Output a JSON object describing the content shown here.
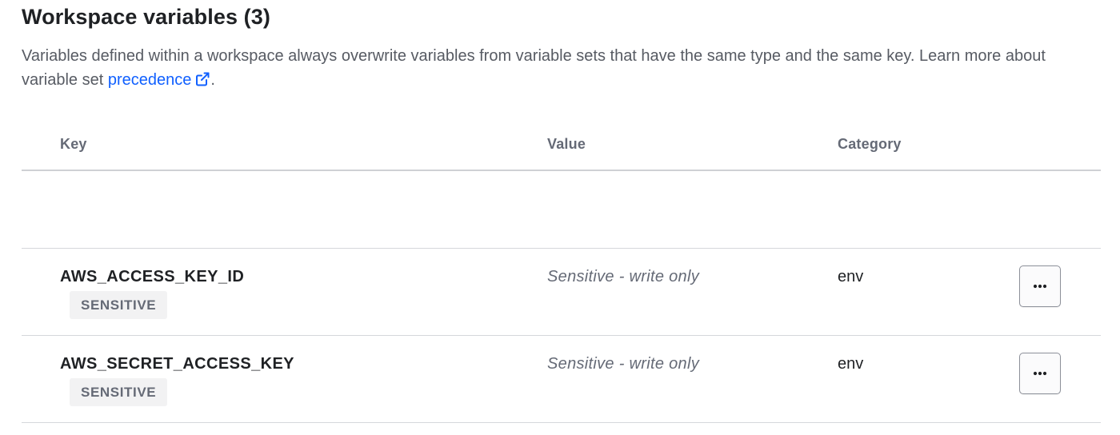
{
  "header": {
    "title": "Workspace variables (3)",
    "description_before": "Variables defined within a workspace always overwrite variables from variable sets that have the same type and the same key. Learn more about variable set ",
    "link_text": "precedence",
    "description_after": ".",
    "link_icon": "external-link-icon"
  },
  "table": {
    "columns": {
      "key": "Key",
      "value": "Value",
      "category": "Category"
    },
    "rows": [
      {
        "key": "AWS_ACCESS_KEY_ID",
        "badge": "SENSITIVE",
        "value": "Sensitive - write only",
        "category": "env",
        "actions_icon": "more-horizontal-icon"
      },
      {
        "key": "AWS_SECRET_ACCESS_KEY",
        "badge": "SENSITIVE",
        "value": "Sensitive - write only",
        "category": "env",
        "actions_icon": "more-horizontal-icon"
      }
    ]
  },
  "colors": {
    "link": "#1060ff",
    "heading": "#1f2124",
    "muted": "#656a76",
    "border": "#d5d7db",
    "badge_bg": "#f2f2f3"
  }
}
